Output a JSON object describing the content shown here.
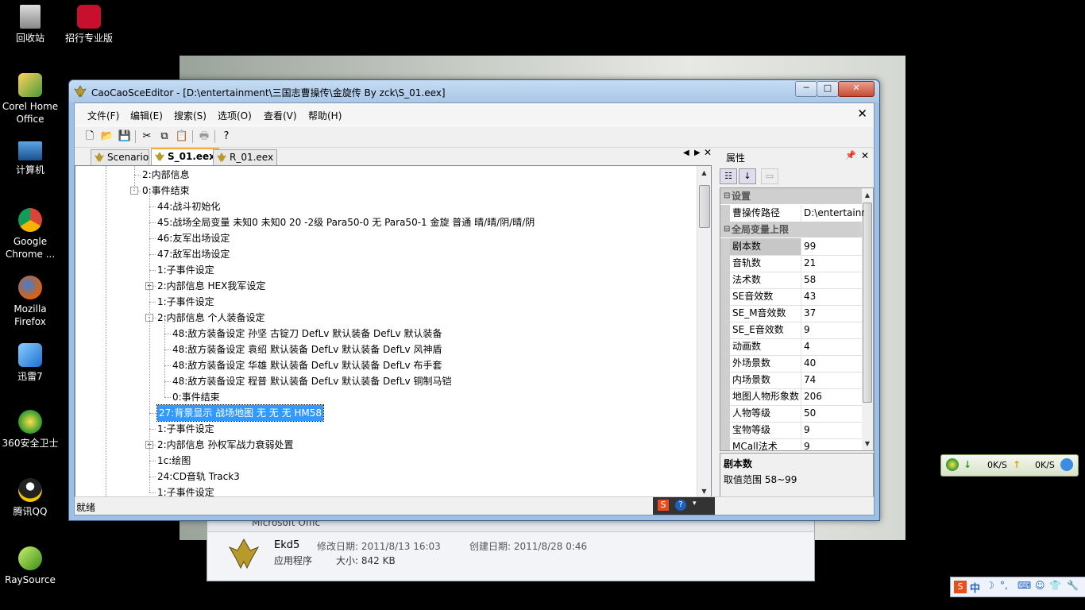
{
  "desktop": {
    "icons": [
      {
        "label": "回收站"
      },
      {
        "label": "招行专业版"
      },
      {
        "label": "Corel Home\nOffice"
      },
      {
        "label": "计算机"
      },
      {
        "label": "Google\nChrome ..."
      },
      {
        "label": "Mozilla\nFirefox"
      },
      {
        "label": "迅雷7"
      },
      {
        "label": "360安全卫士"
      },
      {
        "label": "腾讯QQ"
      },
      {
        "label": "RaySource"
      }
    ]
  },
  "background_window": {
    "toolbar_text": "Microsoft Offic",
    "file_name": "Ekd5",
    "file_type": "应用程序",
    "modified_label": "修改日期: 2011/8/13 16:03",
    "created_label": "创建日期: 2011/8/28 0:46",
    "size_label": "大小: 842 KB"
  },
  "window": {
    "title": "CaoCaoSceEditor - [D:\\entertainment\\三国志曹操传\\金旋传 By zck\\S_01.eex]",
    "menu": [
      "文件(F)",
      "编辑(E)",
      "搜索(S)",
      "选项(O)",
      "查看(V)",
      "帮助(H)"
    ],
    "tabs": [
      {
        "label": "Scenario"
      },
      {
        "label": "S_01.eex"
      },
      {
        "label": "R_01.eex"
      }
    ],
    "status": "就绪"
  },
  "tree": {
    "nodes": [
      {
        "text": "2:内部信息",
        "level": 4,
        "expander": null
      },
      {
        "text": "0:事件结束",
        "level": 4,
        "expander": "-"
      },
      {
        "text": "44:战斗初始化",
        "level": 5,
        "expander": null
      },
      {
        "text": "45:战场全局变量 未知0 未知0 20 -2级 Para50-0 无 Para50-1 金旋 普通 晴/晴/阴/晴/阴",
        "level": 5,
        "expander": null
      },
      {
        "text": "46:友军出场设定",
        "level": 5,
        "expander": null
      },
      {
        "text": "47:敌军出场设定",
        "level": 5,
        "expander": null
      },
      {
        "text": "1:子事件设定",
        "level": 5,
        "expander": null
      },
      {
        "text": "2:内部信息 HEX我军设定",
        "level": 5,
        "expander": "+"
      },
      {
        "text": "1:子事件设定",
        "level": 5,
        "expander": null
      },
      {
        "text": "2:内部信息 个人装备设定",
        "level": 5,
        "expander": "-"
      },
      {
        "text": "48:敌方装备设定 孙坚 古锭刀 DefLv 默认装备 DefLv 默认装备",
        "level": 6,
        "expander": null
      },
      {
        "text": "48:敌方装备设定 袁绍 默认装备 DefLv 默认装备 DefLv 风神盾",
        "level": 6,
        "expander": null
      },
      {
        "text": "48:敌方装备设定 华雄 默认装备 DefLv 默认装备 DefLv 布手套",
        "level": 6,
        "expander": null
      },
      {
        "text": "48:敌方装备设定 程普 默认装备 DefLv 默认装备 DefLv 铜制马铠",
        "level": 6,
        "expander": null
      },
      {
        "text": "0:事件结束",
        "level": 6,
        "expander": null
      },
      {
        "text": "27:背景显示 战场地图 无 无 无 HM58",
        "level": 5,
        "expander": null,
        "selected": true
      },
      {
        "text": "1:子事件设定",
        "level": 5,
        "expander": null
      },
      {
        "text": "2:内部信息 孙权军战力衰弱处置",
        "level": 5,
        "expander": "+"
      },
      {
        "text": "1c:绘图",
        "level": 5,
        "expander": null
      },
      {
        "text": "24:CD音轨 Track3",
        "level": 5,
        "expander": null
      },
      {
        "text": "1:子事件设定",
        "level": 5,
        "expander": null
      }
    ]
  },
  "properties": {
    "title": "属性",
    "categories": [
      {
        "name": "设置",
        "rows": [
          {
            "k": "曹操传路径",
            "v": "D:\\entertainment"
          }
        ]
      },
      {
        "name": "全局变量上限",
        "rows": [
          {
            "k": "剧本数",
            "v": "99",
            "selected": true
          },
          {
            "k": "音轨数",
            "v": "21"
          },
          {
            "k": "法术数",
            "v": "58"
          },
          {
            "k": "SE音效数",
            "v": "43"
          },
          {
            "k": "SE_M音效数",
            "v": "37"
          },
          {
            "k": "SE_E音效数",
            "v": "9"
          },
          {
            "k": "动画数",
            "v": "4"
          },
          {
            "k": "外场景数",
            "v": "40"
          },
          {
            "k": "内场景数",
            "v": "74"
          },
          {
            "k": "地图人物形象数",
            "v": "206"
          },
          {
            "k": "人物等级",
            "v": "50"
          },
          {
            "k": "宝物等级",
            "v": "9"
          },
          {
            "k": "MCall法术",
            "v": "9"
          }
        ]
      }
    ],
    "desc_title": "剧本数",
    "desc_text": "取值范围 58~99"
  },
  "netmeter": {
    "down": "0K/S",
    "up": "0K/S"
  },
  "ime": {
    "mode": "中"
  },
  "colors": {
    "selection": "#3399ff",
    "titlebar": "#b8d2ee"
  }
}
